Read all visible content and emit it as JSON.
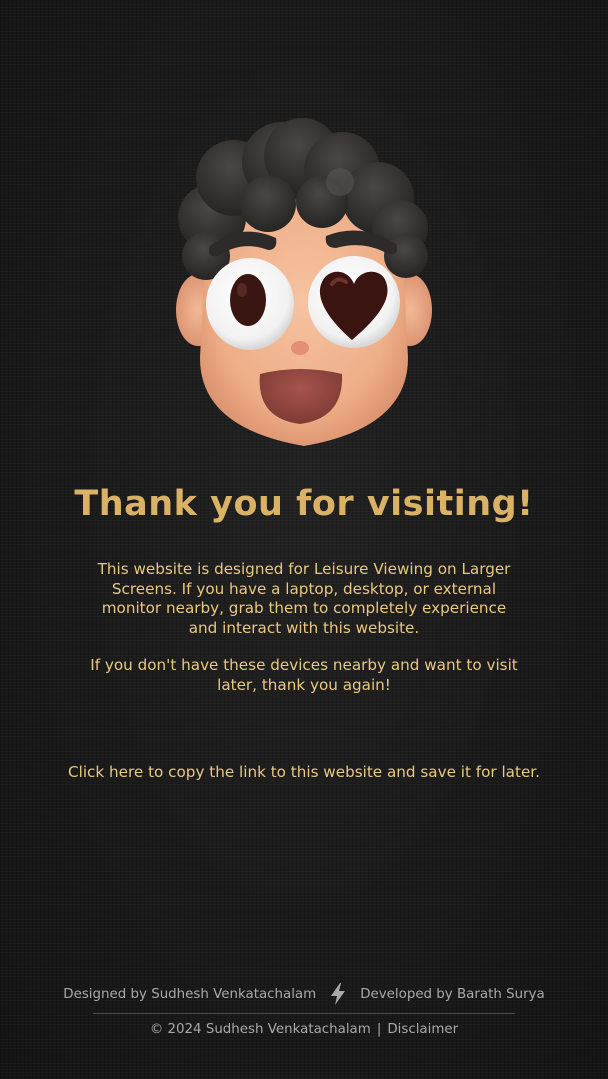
{
  "headline": "Thank you for visiting!",
  "message": {
    "paragraph1": "This website is designed for Leisure Viewing on Larger Screens. If you have a laptop, desktop, or external monitor nearby, grab them to completely experience and interact with this website.",
    "paragraph2": "If you don't have these devices nearby and want to visit later, thank you again!"
  },
  "copy_link": "Click here to copy the link to this website and save it for later.",
  "footer": {
    "designed_by": "Designed by Sudhesh Venkatachalam",
    "developed_by": "Developed by Barath Surya",
    "copyright": "© 2024 Sudhesh Venkatachalam",
    "separator": "|",
    "disclaimer": "Disclaimer"
  },
  "icons": {
    "avatar": "avatar-heart-eyes-icon",
    "separator": "lightning-bolt-icon"
  },
  "colors": {
    "background": "#1a1a1a",
    "accent_gold": "#d9b266",
    "body_text": "#e9c882",
    "footer_text": "#a9a9a9"
  }
}
